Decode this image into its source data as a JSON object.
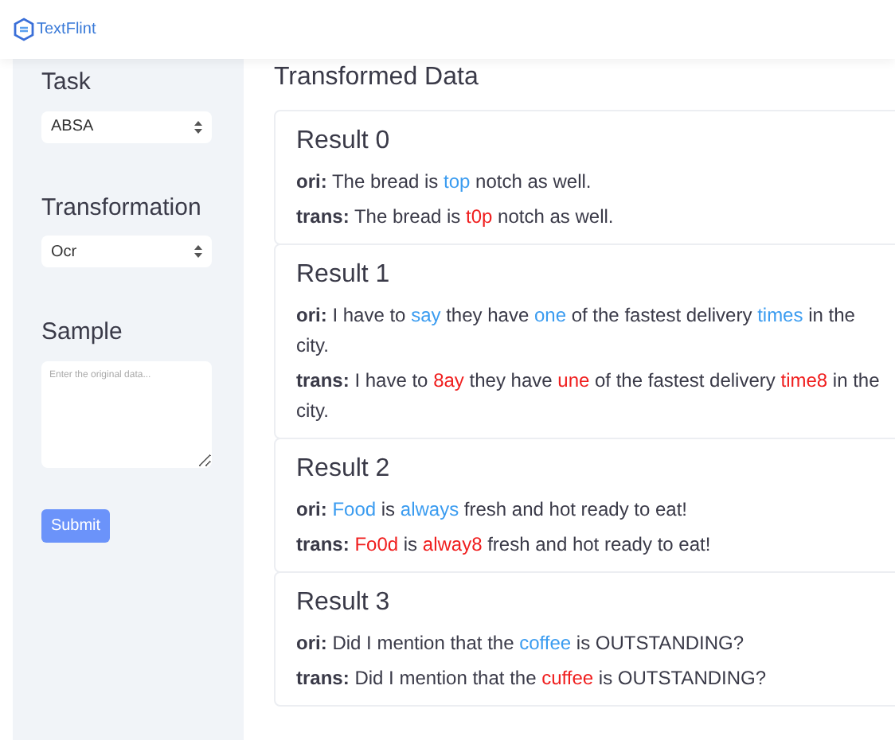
{
  "header": {
    "logo_text": "TextFlint"
  },
  "sidebar": {
    "fields": [
      {
        "kind": "select",
        "label": "Task",
        "value": "ABSA"
      },
      {
        "kind": "select",
        "label": "Transformation",
        "value": "Ocr"
      },
      {
        "kind": "textarea",
        "label": "Sample",
        "placeholder": "Enter the original data..."
      }
    ],
    "submit": "Submit"
  },
  "main": {
    "title": "Transformed Data",
    "results": [
      {
        "title": "Result 0",
        "lines": [
          {
            "kind": "ori",
            "label": "ori:",
            "segments": [
              {
                "text": "The bread is ",
                "highlight": false
              },
              {
                "text": "top",
                "highlight": true
              },
              {
                "text": " notch as well.",
                "highlight": false
              }
            ]
          },
          {
            "kind": "trans",
            "label": "trans:",
            "segments": [
              {
                "text": "The bread is ",
                "highlight": false
              },
              {
                "text": "t0p",
                "highlight": true
              },
              {
                "text": " notch as well.",
                "highlight": false
              }
            ]
          }
        ]
      },
      {
        "title": "Result 1",
        "lines": [
          {
            "kind": "ori",
            "label": "ori:",
            "segments": [
              {
                "text": "I have to ",
                "highlight": false
              },
              {
                "text": "say",
                "highlight": true
              },
              {
                "text": " they have ",
                "highlight": false
              },
              {
                "text": "one",
                "highlight": true
              },
              {
                "text": " of the fastest delivery ",
                "highlight": false
              },
              {
                "text": "times",
                "highlight": true
              },
              {
                "text": " in the city.",
                "highlight": false
              }
            ]
          },
          {
            "kind": "trans",
            "label": "trans:",
            "segments": [
              {
                "text": "I have to ",
                "highlight": false
              },
              {
                "text": "8ay",
                "highlight": true
              },
              {
                "text": " they have ",
                "highlight": false
              },
              {
                "text": "une",
                "highlight": true
              },
              {
                "text": " of the fastest delivery ",
                "highlight": false
              },
              {
                "text": "time8",
                "highlight": true
              },
              {
                "text": " in the city.",
                "highlight": false
              }
            ]
          }
        ]
      },
      {
        "title": "Result 2",
        "lines": [
          {
            "kind": "ori",
            "label": "ori:",
            "segments": [
              {
                "text": "Food",
                "highlight": true
              },
              {
                "text": " is ",
                "highlight": false
              },
              {
                "text": "always",
                "highlight": true
              },
              {
                "text": " fresh and hot ready to eat!",
                "highlight": false
              }
            ]
          },
          {
            "kind": "trans",
            "label": "trans:",
            "segments": [
              {
                "text": "Fo0d",
                "highlight": true
              },
              {
                "text": " is ",
                "highlight": false
              },
              {
                "text": "alway8",
                "highlight": true
              },
              {
                "text": " fresh and hot ready to eat!",
                "highlight": false
              }
            ]
          }
        ]
      },
      {
        "title": "Result 3",
        "lines": [
          {
            "kind": "ori",
            "label": "ori:",
            "segments": [
              {
                "text": "Did I mention that the ",
                "highlight": false
              },
              {
                "text": "coffee",
                "highlight": true
              },
              {
                "text": " is OUTSTANDING?",
                "highlight": false
              }
            ]
          },
          {
            "kind": "trans",
            "label": "trans:",
            "segments": [
              {
                "text": "Did I mention that the ",
                "highlight": false
              },
              {
                "text": "cuffee",
                "highlight": true
              },
              {
                "text": " is OUTSTANDING?",
                "highlight": false
              }
            ]
          }
        ]
      }
    ]
  }
}
